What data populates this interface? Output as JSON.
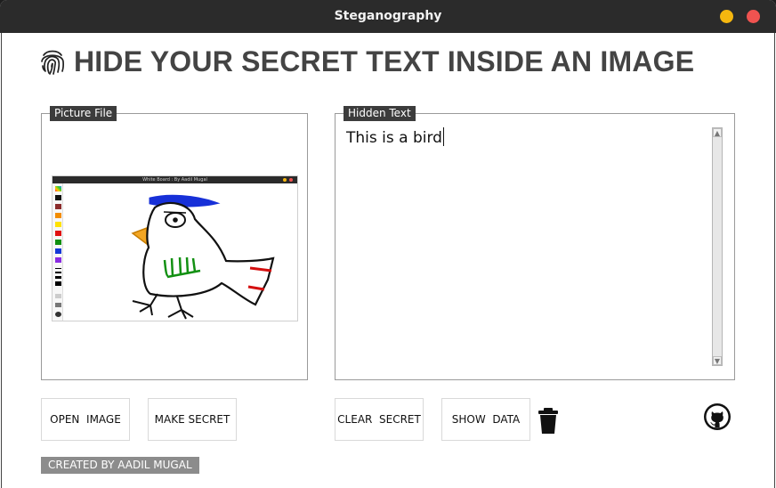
{
  "window": {
    "title": "Steganography",
    "min_color": "#f5b70f",
    "close_color": "#ef5350"
  },
  "header": {
    "heading": "HIDE YOUR SECRET TEXT INSIDE AN IMAGE",
    "icon": "fingerprint-icon"
  },
  "picture_panel": {
    "label": "Picture File",
    "preview": {
      "title": "White Board : By Aadil Mugal",
      "description": "drawing of a bird on a whiteboard app"
    }
  },
  "text_panel": {
    "label": "Hidden Text",
    "value": "This is a bird"
  },
  "buttons": {
    "open_image": "OPEN  IMAGE",
    "make_secret": "MAKE SECRET",
    "clear_secret": "CLEAR  SECRET",
    "show_data": "SHOW  DATA"
  },
  "icons": {
    "delete": "trash-icon",
    "github": "github-icon"
  },
  "footer": {
    "credit": "CREATED BY AADIL MUGAL"
  }
}
